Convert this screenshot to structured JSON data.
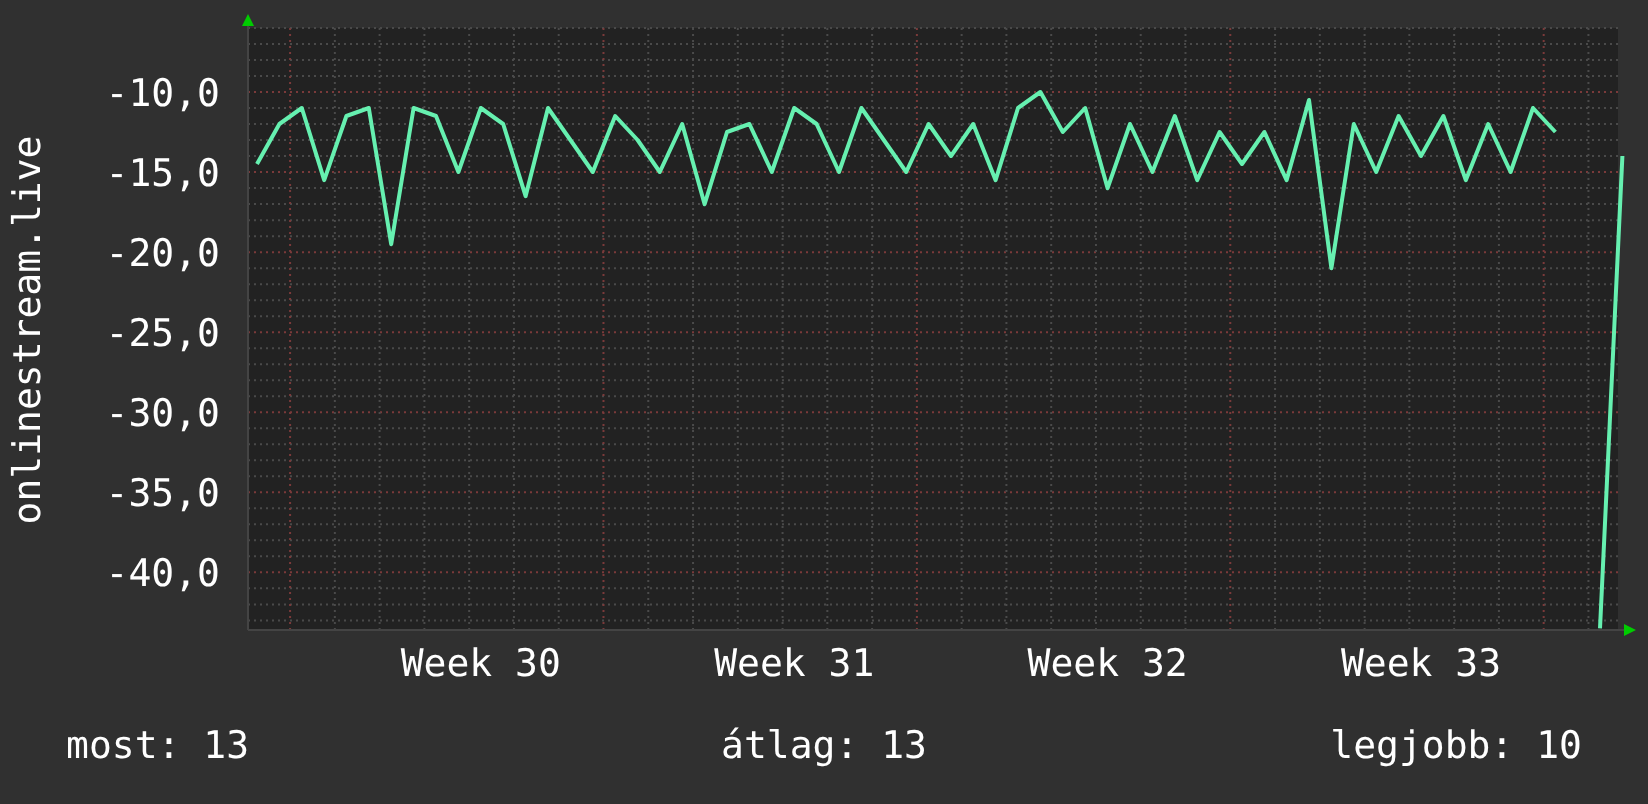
{
  "chart": {
    "chart_data": {
      "type": "line",
      "ylabel": "onlinestream.live",
      "categories": [
        null,
        null,
        null,
        null,
        null,
        null,
        null,
        null,
        null,
        null,
        "Week 30",
        null,
        null,
        null,
        null,
        null,
        null,
        null,
        null,
        null,
        null,
        null,
        null,
        null,
        "Week 31",
        null,
        null,
        null,
        null,
        null,
        null,
        null,
        null,
        null,
        null,
        null,
        null,
        null,
        "Week 32",
        null,
        null,
        null,
        null,
        null,
        null,
        null,
        null,
        null,
        null,
        null,
        null,
        null,
        "Week 33",
        null,
        null,
        null,
        null,
        null,
        null,
        null,
        null,
        null
      ],
      "series": [
        {
          "color": "#66f0b0",
          "values": [
            -14.5,
            -12,
            -11,
            -15.5,
            -11.5,
            -11,
            -19.5,
            -11,
            -11.5,
            -15,
            -11,
            -12,
            -16.5,
            -11,
            -13,
            -15,
            -11.5,
            -13,
            -15,
            -12,
            -17,
            -12.5,
            -12,
            -15,
            -11,
            -12,
            -15,
            -11,
            -13,
            -15,
            -12,
            -14,
            -12,
            -15.5,
            -11,
            -10,
            -12.5,
            -11,
            -16,
            -12,
            -15,
            -11.5,
            -15.5,
            -12.5,
            -14.5,
            -12.5,
            -15.5,
            -10.5,
            -21,
            -12,
            -15,
            -11.5,
            -14,
            -11.5,
            -15.5,
            -12,
            -15,
            -11,
            -12.5,
            null,
            -43.5,
            -14
          ]
        }
      ],
      "grid": true,
      "ylim": [
        -43.6,
        -6
      ],
      "yticks": [
        {
          "value": -10,
          "label": "-10,0"
        },
        {
          "value": -15,
          "label": "-15,0"
        },
        {
          "value": -20,
          "label": "-20,0"
        },
        {
          "value": -25,
          "label": "-25,0"
        },
        {
          "value": -30,
          "label": "-30,0"
        },
        {
          "value": -35,
          "label": "-35,0"
        },
        {
          "value": -40,
          "label": "-40,0"
        }
      ]
    }
  },
  "legend": [
    "most: 13",
    "átlag: 13",
    "legjobb: 10"
  ]
}
